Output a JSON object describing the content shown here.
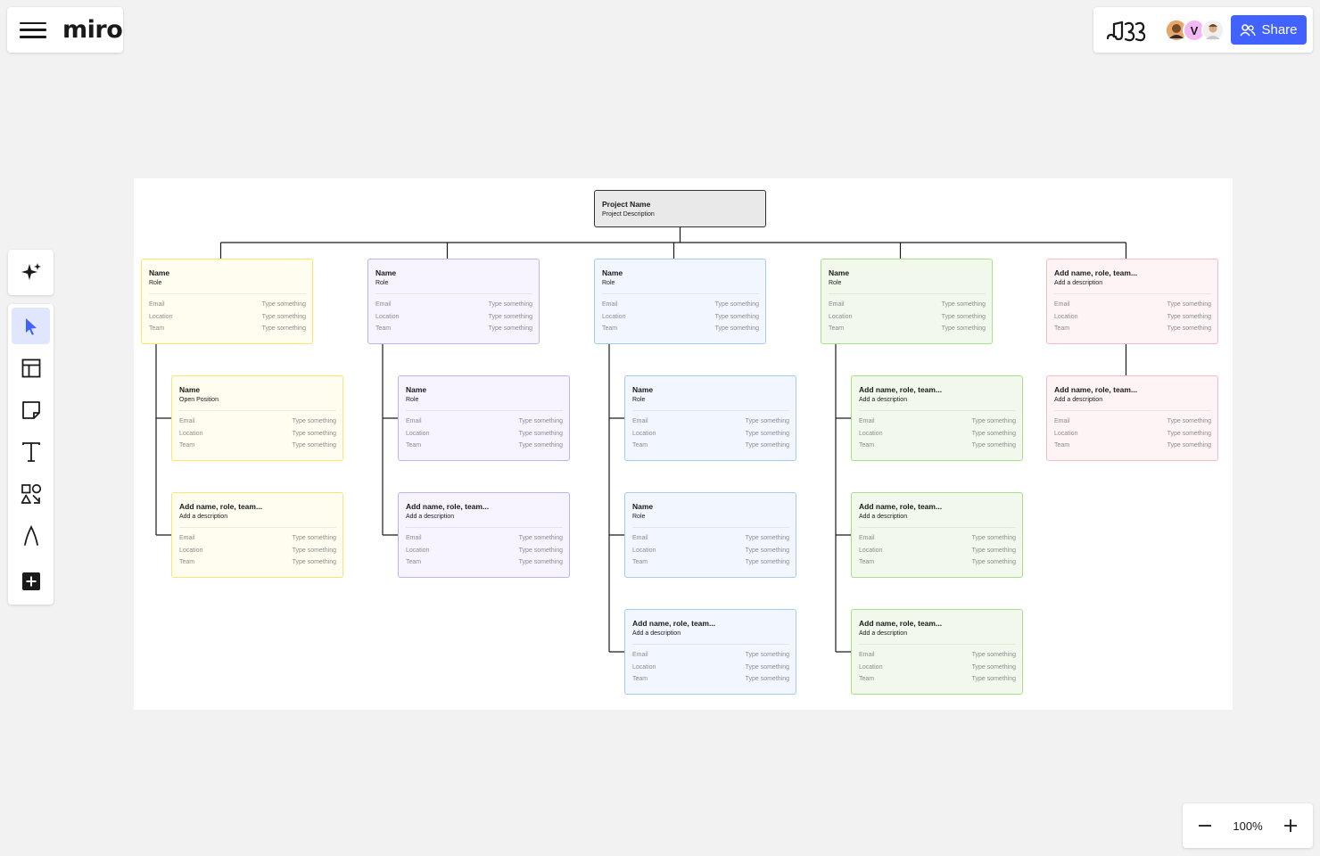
{
  "app": {
    "logo": "miro"
  },
  "header": {
    "share_label": "Share",
    "avatar_initial": "V"
  },
  "zoom": {
    "level": "100%"
  },
  "org_chart": {
    "root": {
      "name": "Project Name",
      "description": "Project Description"
    },
    "field_labels": [
      "Email",
      "Location",
      "Team"
    ],
    "field_value": "Type something",
    "columns": [
      {
        "color": "yellow",
        "cards": [
          {
            "name": "Name",
            "role": "Role"
          },
          {
            "name": "Name",
            "role": "Open Position"
          },
          {
            "name": "Add name, role, team...",
            "role": "Add a description"
          }
        ]
      },
      {
        "color": "purple",
        "cards": [
          {
            "name": "Name",
            "role": "Role"
          },
          {
            "name": "Name",
            "role": "Role"
          },
          {
            "name": "Add name, role, team...",
            "role": "Add a description"
          }
        ]
      },
      {
        "color": "blue",
        "cards": [
          {
            "name": "Name",
            "role": "Role"
          },
          {
            "name": "Name",
            "role": "Role"
          },
          {
            "name": "Name",
            "role": "Role"
          },
          {
            "name": "Add name, role, team...",
            "role": "Add a description"
          }
        ]
      },
      {
        "color": "green",
        "cards": [
          {
            "name": "Name",
            "role": "Role"
          },
          {
            "name": "Add name, role, team...",
            "role": "Add a description"
          },
          {
            "name": "Add name, role, team...",
            "role": "Add a description"
          },
          {
            "name": "Add name, role, team...",
            "role": "Add a description"
          }
        ]
      },
      {
        "color": "pink",
        "cards": [
          {
            "name": "Add name, role, team...",
            "role": "Add a description"
          },
          {
            "name": "Add name, role, team...",
            "role": "Add a description"
          }
        ]
      }
    ]
  }
}
